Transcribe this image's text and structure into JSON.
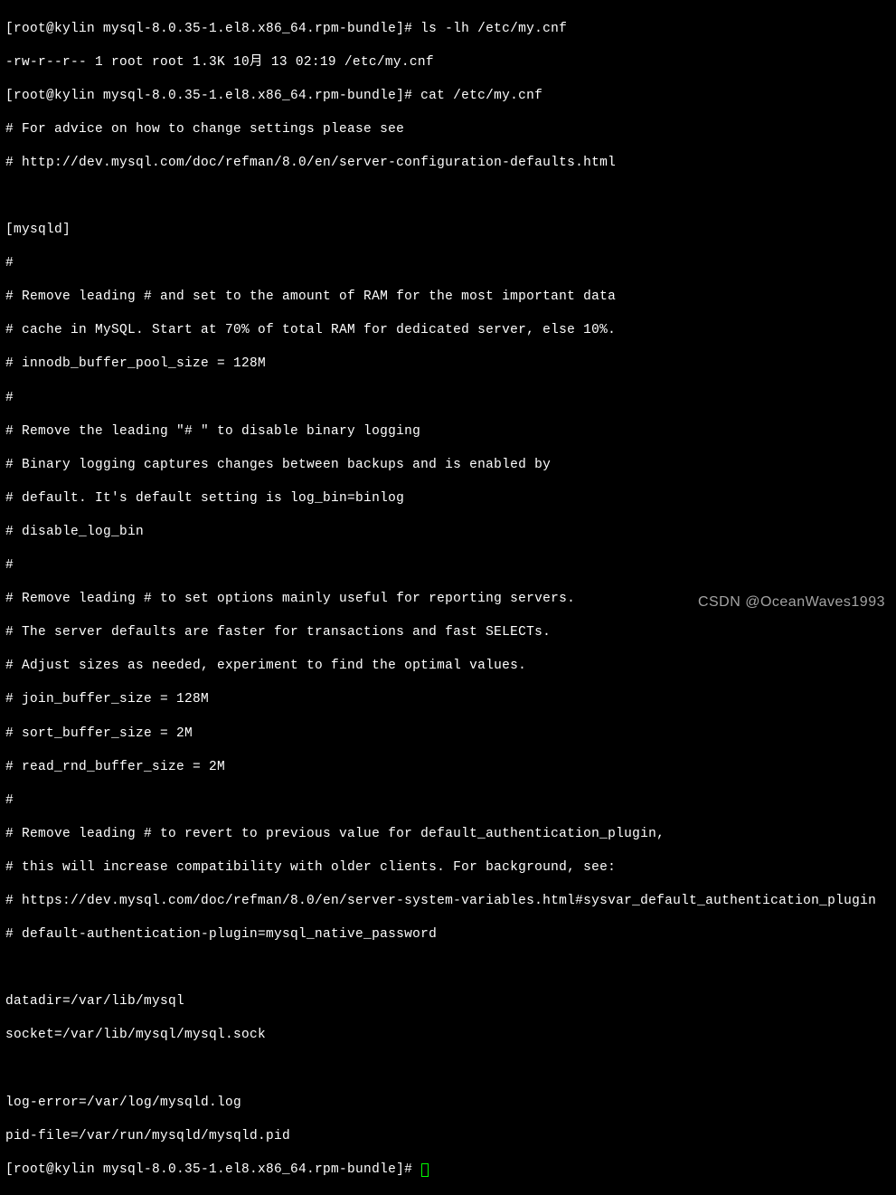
{
  "prompt1": "[root@kylin mysql-8.0.35-1.el8.x86_64.rpm-bundle]# ",
  "cmd1": "ls -lh /etc/my.cnf",
  "out1": "-rw-r--r-- 1 root root 1.3K 10月 13 02:19 /etc/my.cnf",
  "prompt2": "[root@kylin mysql-8.0.35-1.el8.x86_64.rpm-bundle]# ",
  "cmd2": "cat /etc/my.cnf",
  "cfg": {
    "l1": "# For advice on how to change settings please see",
    "l2": "# http://dev.mysql.com/doc/refman/8.0/en/server-configuration-defaults.html",
    "l3": "",
    "l4": "[mysqld]",
    "l5": "#",
    "l6": "# Remove leading # and set to the amount of RAM for the most important data",
    "l7": "# cache in MySQL. Start at 70% of total RAM for dedicated server, else 10%.",
    "l8": "# innodb_buffer_pool_size = 128M",
    "l9": "#",
    "l10": "# Remove the leading \"# \" to disable binary logging",
    "l11": "# Binary logging captures changes between backups and is enabled by",
    "l12": "# default. It's default setting is log_bin=binlog",
    "l13": "# disable_log_bin",
    "l14": "#",
    "l15": "# Remove leading # to set options mainly useful for reporting servers.",
    "l16": "# The server defaults are faster for transactions and fast SELECTs.",
    "l17": "# Adjust sizes as needed, experiment to find the optimal values.",
    "l18": "# join_buffer_size = 128M",
    "l19": "# sort_buffer_size = 2M",
    "l20": "# read_rnd_buffer_size = 2M",
    "l21": "#",
    "l22": "# Remove leading # to revert to previous value for default_authentication_plugin,",
    "l23": "# this will increase compatibility with older clients. For background, see:",
    "l24": "# https://dev.mysql.com/doc/refman/8.0/en/server-system-variables.html#sysvar_default_authentication_plugin",
    "l25": "# default-authentication-plugin=mysql_native_password",
    "l26": "",
    "l27": "datadir=/var/lib/mysql",
    "l28": "socket=/var/lib/mysql/mysql.sock",
    "l29": "",
    "l30": "log-error=/var/log/mysqld.log",
    "l31": "pid-file=/var/run/mysqld/mysqld.pid"
  },
  "prompt3": "[root@kylin mysql-8.0.35-1.el8.x86_64.rpm-bundle]# ",
  "watermark": "CSDN @OceanWaves1993"
}
